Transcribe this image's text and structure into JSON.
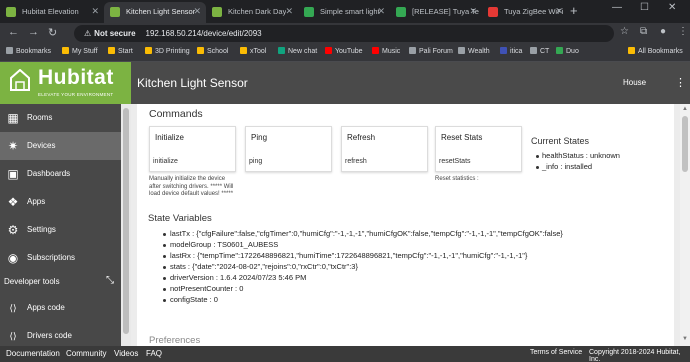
{
  "browser": {
    "tabs": [
      {
        "title": "Hubitat Elevation",
        "active": false,
        "favicon_color": "#7cb342"
      },
      {
        "title": "Kitchen Light Sensor",
        "active": true,
        "favicon_color": "#7cb342"
      },
      {
        "title": "Kitchen Dark Day",
        "active": false,
        "favicon_color": "#7cb342"
      },
      {
        "title": "Simple smart light",
        "active": false,
        "favicon_color": "#34a853"
      },
      {
        "title": "[RELEASE] Tuya Te",
        "active": false,
        "favicon_color": "#34a853"
      },
      {
        "title": "Tuya ZigBee WiFi",
        "active": false,
        "favicon_color": "#e53935"
      }
    ],
    "new_tab_label": "+",
    "minimize": "—",
    "maximize": "☐",
    "close": "✕",
    "address": {
      "security_label": "Not secure",
      "url": "192.168.50.214/device/edit/2093"
    },
    "bookmarks": [
      {
        "label": "Bookmarks",
        "color": "#9aa0a6"
      },
      {
        "label": "My Stuff",
        "color": "#fbbc04"
      },
      {
        "label": "Start",
        "color": "#fbbc04"
      },
      {
        "label": "3D Printing",
        "color": "#fbbc04"
      },
      {
        "label": "School",
        "color": "#fbbc04"
      },
      {
        "label": "xTool",
        "color": "#fbbc04"
      },
      {
        "label": "New chat",
        "color": "#10a37f"
      },
      {
        "label": "YouTube",
        "color": "#ff0000"
      },
      {
        "label": "Music",
        "color": "#ff0000"
      },
      {
        "label": "Pali Forum",
        "color": "#9aa0a6"
      },
      {
        "label": "Wealth",
        "color": "#9aa0a6"
      },
      {
        "label": "itica",
        "color": "#3f51b5"
      },
      {
        "label": "CT",
        "color": "#9aa0a6"
      },
      {
        "label": "Duo",
        "color": "#34a853"
      },
      {
        "label": "All Bookmarks",
        "color": "#fbbc04"
      }
    ]
  },
  "hubitat": {
    "brand": "Hubitat",
    "tagline": "ELEVATE YOUR ENVIRONMENT",
    "page_title": "Kitchen Light Sensor",
    "location": "House",
    "nav": [
      {
        "label": "Rooms",
        "icon": "rooms-icon",
        "glyph": "▦"
      },
      {
        "label": "Devices",
        "icon": "devices-icon",
        "glyph": "✷",
        "active": true
      },
      {
        "label": "Dashboards",
        "icon": "dashboards-icon",
        "glyph": "▣"
      },
      {
        "label": "Apps",
        "icon": "apps-icon",
        "glyph": "❖"
      },
      {
        "label": "Settings",
        "icon": "settings-icon",
        "glyph": "⚙"
      },
      {
        "label": "Subscriptions",
        "icon": "subscriptions-icon",
        "glyph": "◉"
      }
    ],
    "developer_tools_label": "Developer tools",
    "dev_nav": [
      {
        "label": "Apps code",
        "icon": "apps-code-icon",
        "glyph": "⟨⟩"
      },
      {
        "label": "Drivers code",
        "icon": "drivers-code-icon",
        "glyph": "⟨⟩"
      }
    ],
    "colors": {
      "brand_green": "#7cb342",
      "header_gray": "#4a4a4a",
      "sidebar_gray": "#484848"
    }
  },
  "commands": {
    "title": "Commands",
    "items": [
      {
        "name": "Initialize",
        "value": "initialize",
        "note": "Manually initialize the device after switching drivers. ***** Will load device default values! *****"
      },
      {
        "name": "Ping",
        "value": "ping",
        "note": ""
      },
      {
        "name": "Refresh",
        "value": "refresh",
        "note": ""
      },
      {
        "name": "Reset Stats",
        "value": "resetStats",
        "note": "Reset statistics :"
      }
    ]
  },
  "current_states": {
    "title": "Current States",
    "items": [
      "healthStatus : unknown",
      "_info : installed"
    ]
  },
  "state_variables": {
    "title": "State Variables",
    "items": [
      "lastTx : {\"cfgFailure\":false,\"cfgTimer\":0,\"humiCfg\":\"-1,-1,-1\",\"humiCfgOK\":false,\"tempCfg\":\"-1,-1,-1\",\"tempCfgOK\":false}",
      "modelGroup : TS0601_AUBESS",
      "lastRx : {\"tempTime\":1722648896821,\"humiTime\":1722648896821,\"tempCfg\":\"-1,-1,-1\",\"humiCfg\":\"-1,-1,-1\"}",
      "stats : {\"date\":\"2024-08-02\",\"rejoins\":0,\"rxCtr\":0,\"txCtr\":3}",
      "driverVersion : 1.6.4 2024/07/23 5:46 PM",
      "notPresentCounter : 0",
      "configState : 0"
    ]
  },
  "preferences_title": "Preferences",
  "footer": {
    "links": [
      "Documentation",
      "Community",
      "Videos",
      "FAQ"
    ],
    "terms": "Terms of Service",
    "copyright": "Copyright 2018-2024 Hubitat, Inc."
  }
}
